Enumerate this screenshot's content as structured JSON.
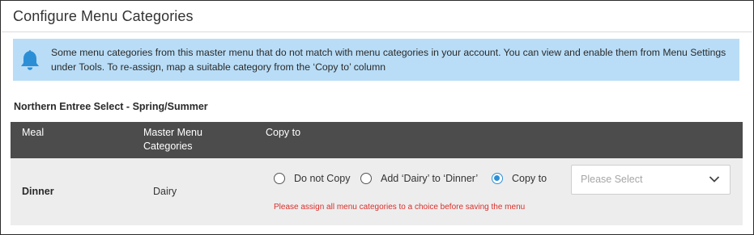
{
  "dialog": {
    "title": "Configure Menu Categories"
  },
  "info_banner": {
    "icon": "bell-icon",
    "message": "Some menu categories from this master menu that do not match with menu categories in your account. You can view and enable them from Menu Settings under Tools. To re-assign, map a suitable category from the ‘Copy to’ column"
  },
  "menu": {
    "name": "Northern Entree Select - Spring/Summer"
  },
  "table": {
    "columns": [
      "Meal",
      "Master Menu Categories",
      "Copy to"
    ],
    "rows": [
      {
        "meal": "Dinner",
        "master_category": "Dairy",
        "options": [
          {
            "label": "Do not Copy",
            "checked": false
          },
          {
            "label": "Add ‘Dairy’ to ‘Dinner’",
            "checked": false
          },
          {
            "label": "Copy to",
            "checked": true
          }
        ],
        "select_placeholder": "Please Select",
        "error": "Please assign all menu categories to a choice before saving the menu"
      }
    ]
  },
  "colors": {
    "banner_bg": "#b9ddf7",
    "bell_icon": "#2c8fd6",
    "header_bg": "#4c4c4c",
    "row_bg": "#ededed",
    "radio_selected": "#2c8fd6",
    "error_text": "#d9302c"
  }
}
